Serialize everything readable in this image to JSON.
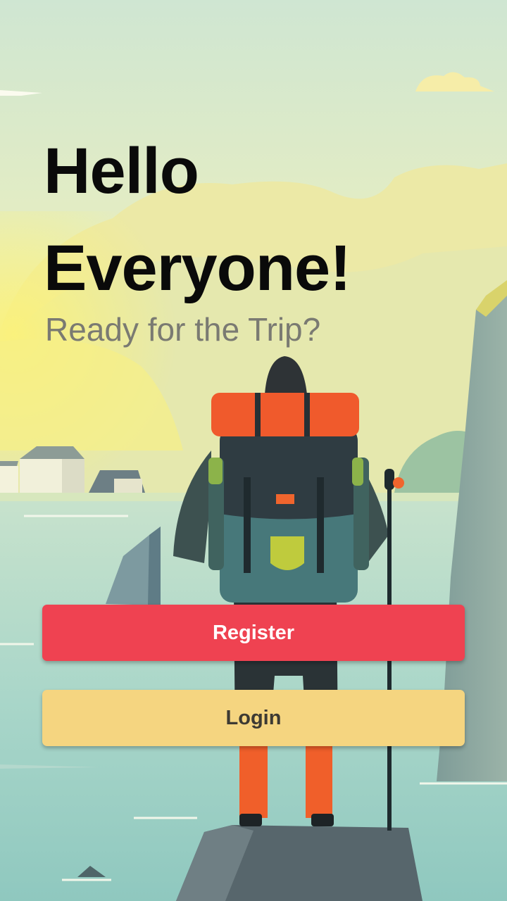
{
  "hero": {
    "title_line1": "Hello",
    "title_line2": "Everyone!",
    "subtitle": "Ready for the Trip?",
    "illustration": "hiker-with-backpack-illustration"
  },
  "actions": {
    "register_label": "Register",
    "login_label": "Login"
  },
  "colors": {
    "register_button": "#ef4251",
    "login_button": "#f5d580",
    "title_text": "#0a0a0a",
    "subtitle_text": "#7a7a72"
  }
}
